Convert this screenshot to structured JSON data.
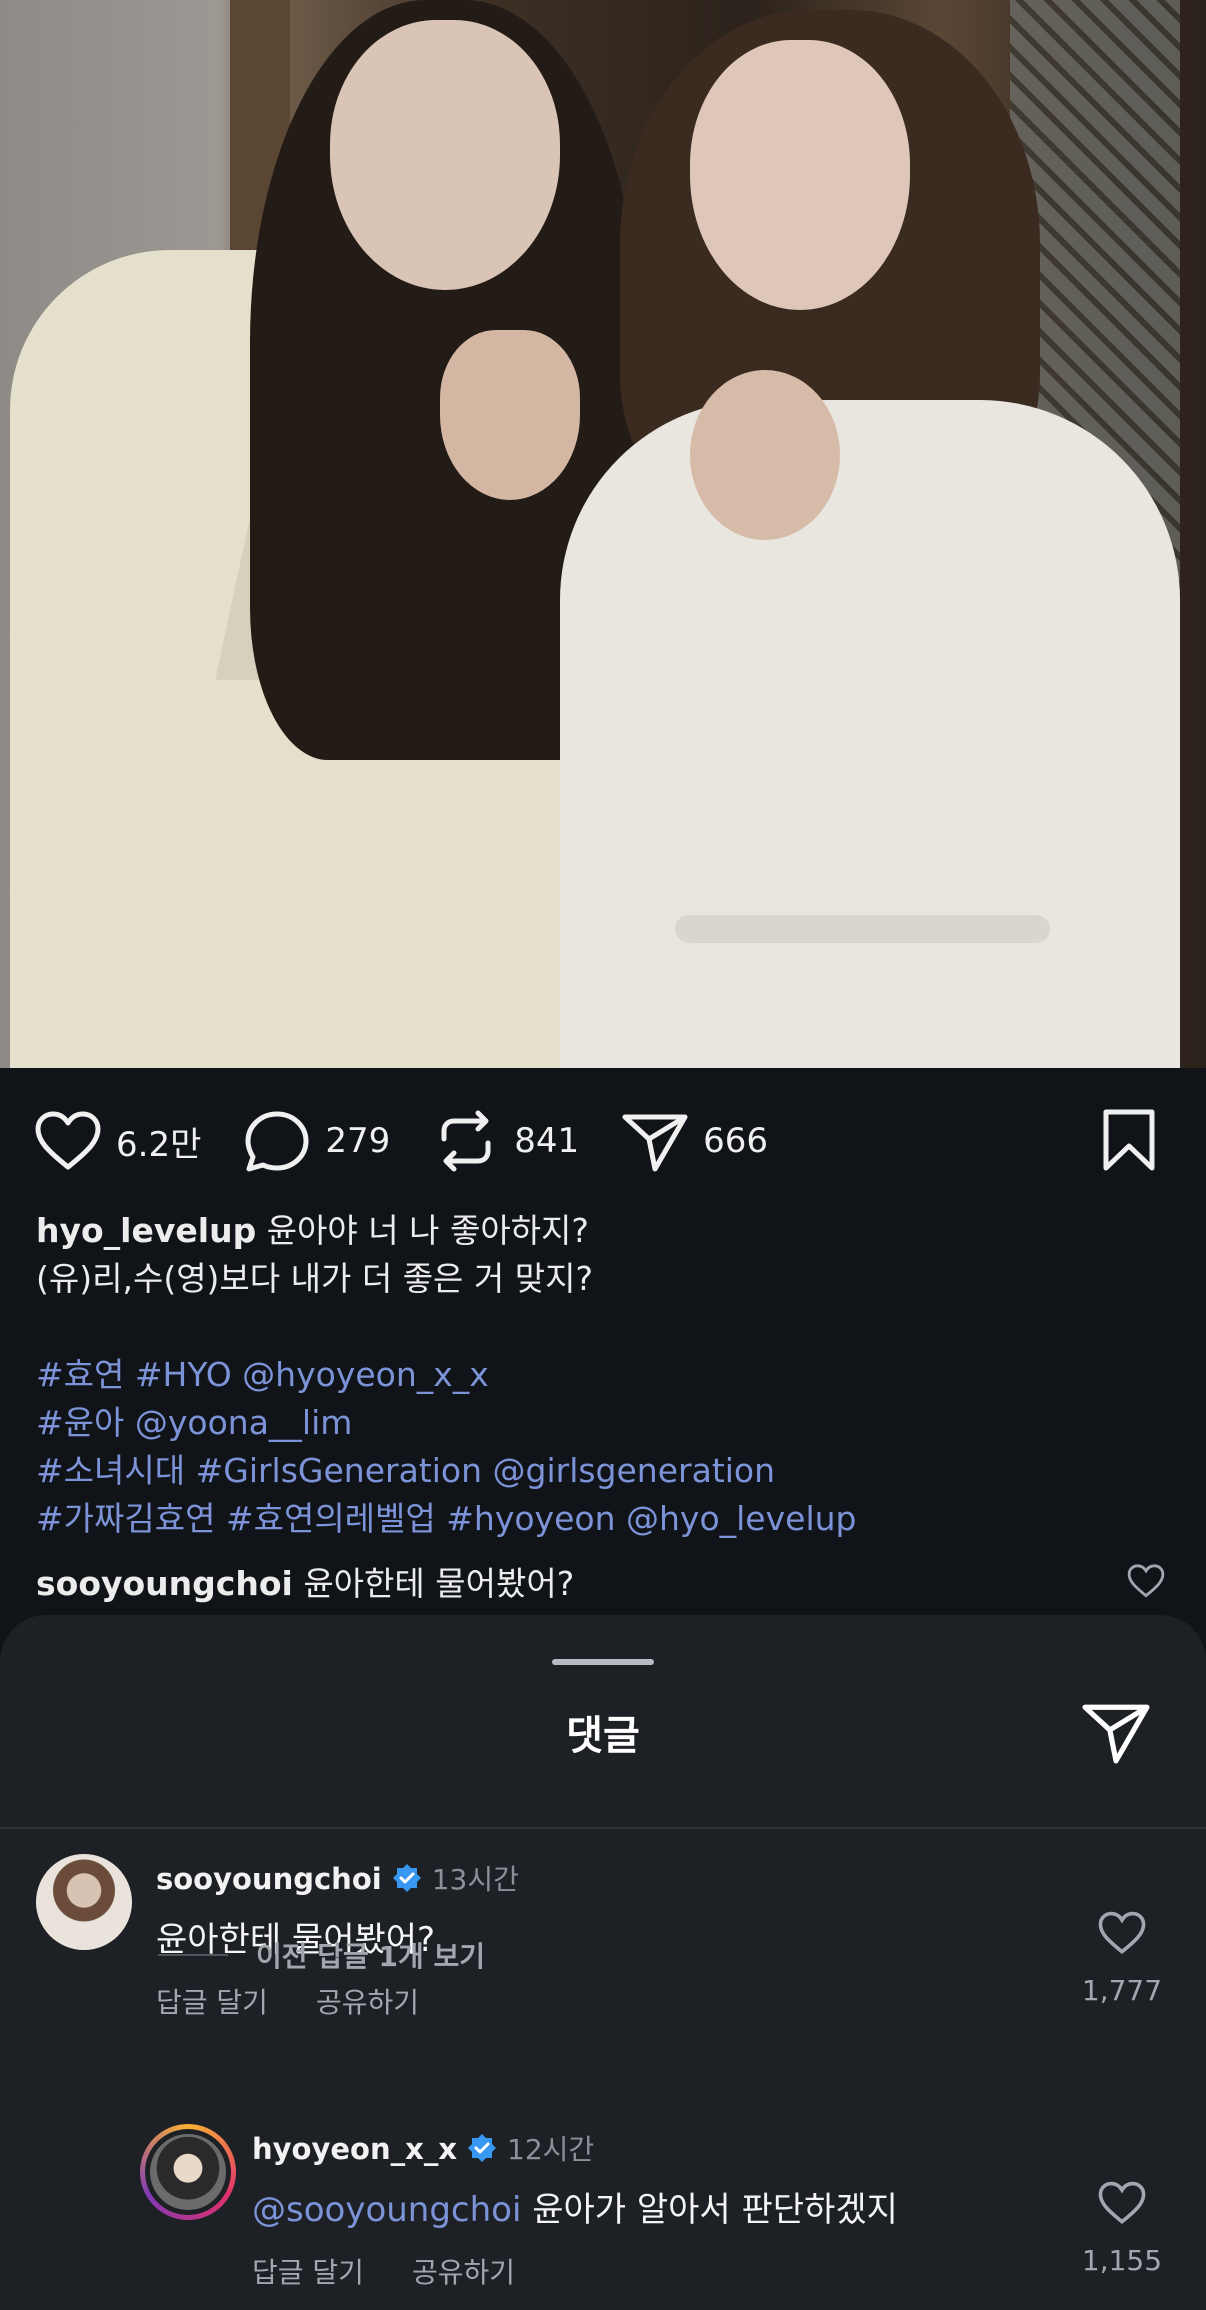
{
  "post": {
    "photo_alt": "",
    "stats": {
      "likes": "6.2만",
      "comments": "279",
      "reposts": "841",
      "shares": "666"
    },
    "caption": {
      "username": "hyo_levelup",
      "line1": " 윤아야 너 나 좋아하지?",
      "line2": "(유)리,수(영)보다 내가 더 좋은 거 맞지?",
      "tags_line1": [
        "#효연",
        "#HYO",
        "@hyoyeon_x_x"
      ],
      "tags_line2": [
        "#윤아",
        "@yoona__lim"
      ],
      "tags_line3": [
        "#소녀시대",
        "#GirlsGeneration",
        "@girlsgeneration"
      ],
      "tags_line4": [
        "#가짜김효연",
        "#효연의레벨업",
        "#hyoyeon",
        "@hyo_levelup"
      ]
    },
    "preview_comment": {
      "username": "sooyoungchoi",
      "text": " 윤아한테 물어봤어?"
    }
  },
  "sheet": {
    "title": "댓글",
    "comments": [
      {
        "username": "sooyoungchoi",
        "time": "13시간",
        "text": "윤아한테 물어봤어?",
        "reply_label": "답글 달기",
        "share_label": "공유하기",
        "likes": "1,777"
      },
      {
        "username": "hyoyeon_x_x",
        "time": "12시간",
        "mention": "@sooyoungchoi",
        "text": " 윤아가 알아서 판단하겠지",
        "reply_label": "답글 달기",
        "share_label": "공유하기",
        "likes": "1,155"
      }
    ],
    "view_previous": "이전 답글 1개 보기"
  },
  "colors": {
    "background": "#101318",
    "sheet": "#1d2025",
    "link": "#7c93d8",
    "verified": "#3897f0"
  }
}
